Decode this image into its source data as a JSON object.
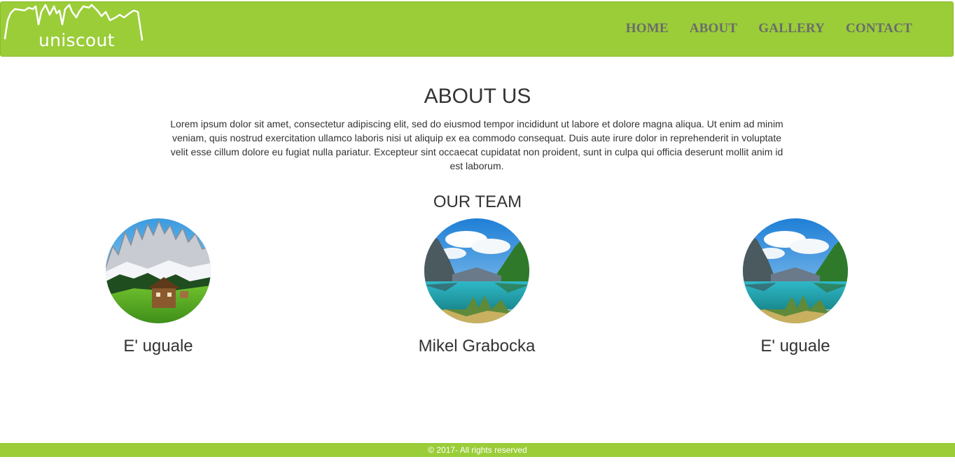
{
  "brand": {
    "logo_text": "uniscout"
  },
  "nav": {
    "items": [
      {
        "label": "HOME"
      },
      {
        "label": "ABOUT"
      },
      {
        "label": "GALLERY"
      },
      {
        "label": "CONTACT"
      }
    ]
  },
  "colors": {
    "accent": "#9acd38",
    "nav_text": "#6b6b6b",
    "body_text": "#333333"
  },
  "about": {
    "title": "ABOUT US",
    "text": "Lorem ipsum dolor sit amet, consectetur adipiscing elit, sed do eiusmod tempor incididunt ut labore et dolore magna aliqua. Ut enim ad minim veniam, quis nostrud exercitation ullamco laboris nisi ut aliquip ex ea commodo consequat. Duis aute irure dolor in reprehenderit in voluptate velit esse cillum dolore eu fugiat nulla pariatur. Excepteur sint occaecat cupidatat non proident, sunt in culpa qui officia deserunt mollit anim id est laborum."
  },
  "team": {
    "title": "OUR TEAM",
    "members": [
      {
        "name": "E' uguale"
      },
      {
        "name": "Mikel Grabocka"
      },
      {
        "name": "E' uguale"
      }
    ]
  },
  "footer": {
    "text": "© 2017- All rights reserved"
  }
}
